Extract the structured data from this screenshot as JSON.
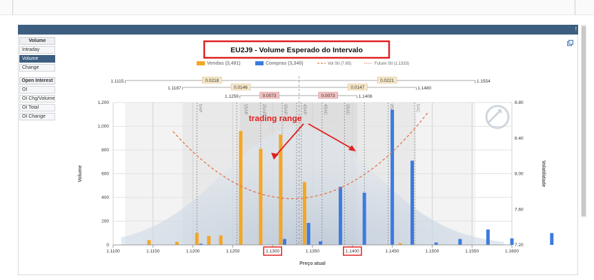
{
  "sidebar": {
    "volume_header": "Volume",
    "volume_items": [
      "Intraday",
      "Volume",
      "Change"
    ],
    "oi_header": "Open Interest",
    "oi_items": [
      "OI",
      "OI Chg/Volume",
      "OI Total",
      "OI Change"
    ],
    "active_item": "Volume"
  },
  "colors": {
    "sales": "#f5a623",
    "purchases": "#3c7be0",
    "vol": "#e8734a",
    "highlight": "#e02020",
    "header_bar": "#3c5e80"
  },
  "chart_data": {
    "type": "bar",
    "title": "EU2J9 - Volume Esperado do Intervalo",
    "xlabel": "Preço atual",
    "ylabel": "Volume",
    "y2label": "Volatilidade",
    "xlim": [
      1.11,
      1.16
    ],
    "ylim": [
      0,
      1200
    ],
    "y2lim": [
      7.2,
      8.8
    ],
    "x_ticks": [
      "1.1100",
      "1.1150",
      "1.1200",
      "1.1250",
      "1.1300",
      "1.1350",
      "1.1400",
      "1.1450",
      "1.1500",
      "1.1550",
      "1.1600"
    ],
    "y_ticks": [
      "0",
      "200",
      "400",
      "600",
      "800",
      "1,000",
      "1,200"
    ],
    "y2_ticks": [
      "7.20",
      "7.60",
      "8.00",
      "8.40",
      "8.80"
    ],
    "highlighted_ticks": [
      "1.1300",
      "1.1400"
    ],
    "legend": [
      {
        "label": "Vendas (3,491)",
        "kind": "bar",
        "color": "#f5a623"
      },
      {
        "label": "Compras (3,340)",
        "kind": "bar",
        "color": "#3c7be0"
      },
      {
        "label": "Vol Stl (7.65)",
        "kind": "dash",
        "color": "#e8734a"
      },
      {
        "label": "Future Stl (1.1333)",
        "kind": "dot",
        "color": "#e8734a"
      }
    ],
    "series": [
      {
        "name": "Vendas",
        "color": "#f5a623",
        "points": [
          [
            1.1145,
            40
          ],
          [
            1.118,
            25
          ],
          [
            1.1205,
            100
          ],
          [
            1.122,
            75
          ],
          [
            1.1235,
            80
          ],
          [
            1.126,
            960
          ],
          [
            1.1285,
            810
          ],
          [
            1.131,
            930
          ],
          [
            1.134,
            530
          ],
          [
            1.146,
            15
          ]
        ]
      },
      {
        "name": "Compras",
        "color": "#3c7be0",
        "points": [
          [
            1.121,
            10
          ],
          [
            1.1315,
            50
          ],
          [
            1.1345,
            185
          ],
          [
            1.136,
            30
          ],
          [
            1.1385,
            490
          ],
          [
            1.1415,
            440
          ],
          [
            1.145,
            1140
          ],
          [
            1.1475,
            710
          ],
          [
            1.1505,
            20
          ],
          [
            1.1535,
            50
          ],
          [
            1.157,
            130
          ],
          [
            1.16,
            55
          ],
          [
            1.165,
            100
          ]
        ]
      }
    ],
    "range_rows": [
      {
        "left": "1.1115",
        "right": "1.1554",
        "diff_left": "0.0218",
        "diff_right": "0.0221"
      },
      {
        "left": "1.1187",
        "right": "1.1480",
        "diff_left": "0.0146",
        "diff_right": "0.0147"
      },
      {
        "left": "1.1259",
        "right": "1.1406",
        "diff_left": "0.0073",
        "diff_right": "0.0073"
      }
    ],
    "level_labels": [
      "5AP",
      "15AP",
      "25AP",
      "35AP",
      "45AP",
      "45AC",
      "35AC",
      "25AC",
      "5AC"
    ],
    "annotation": "trading range"
  }
}
